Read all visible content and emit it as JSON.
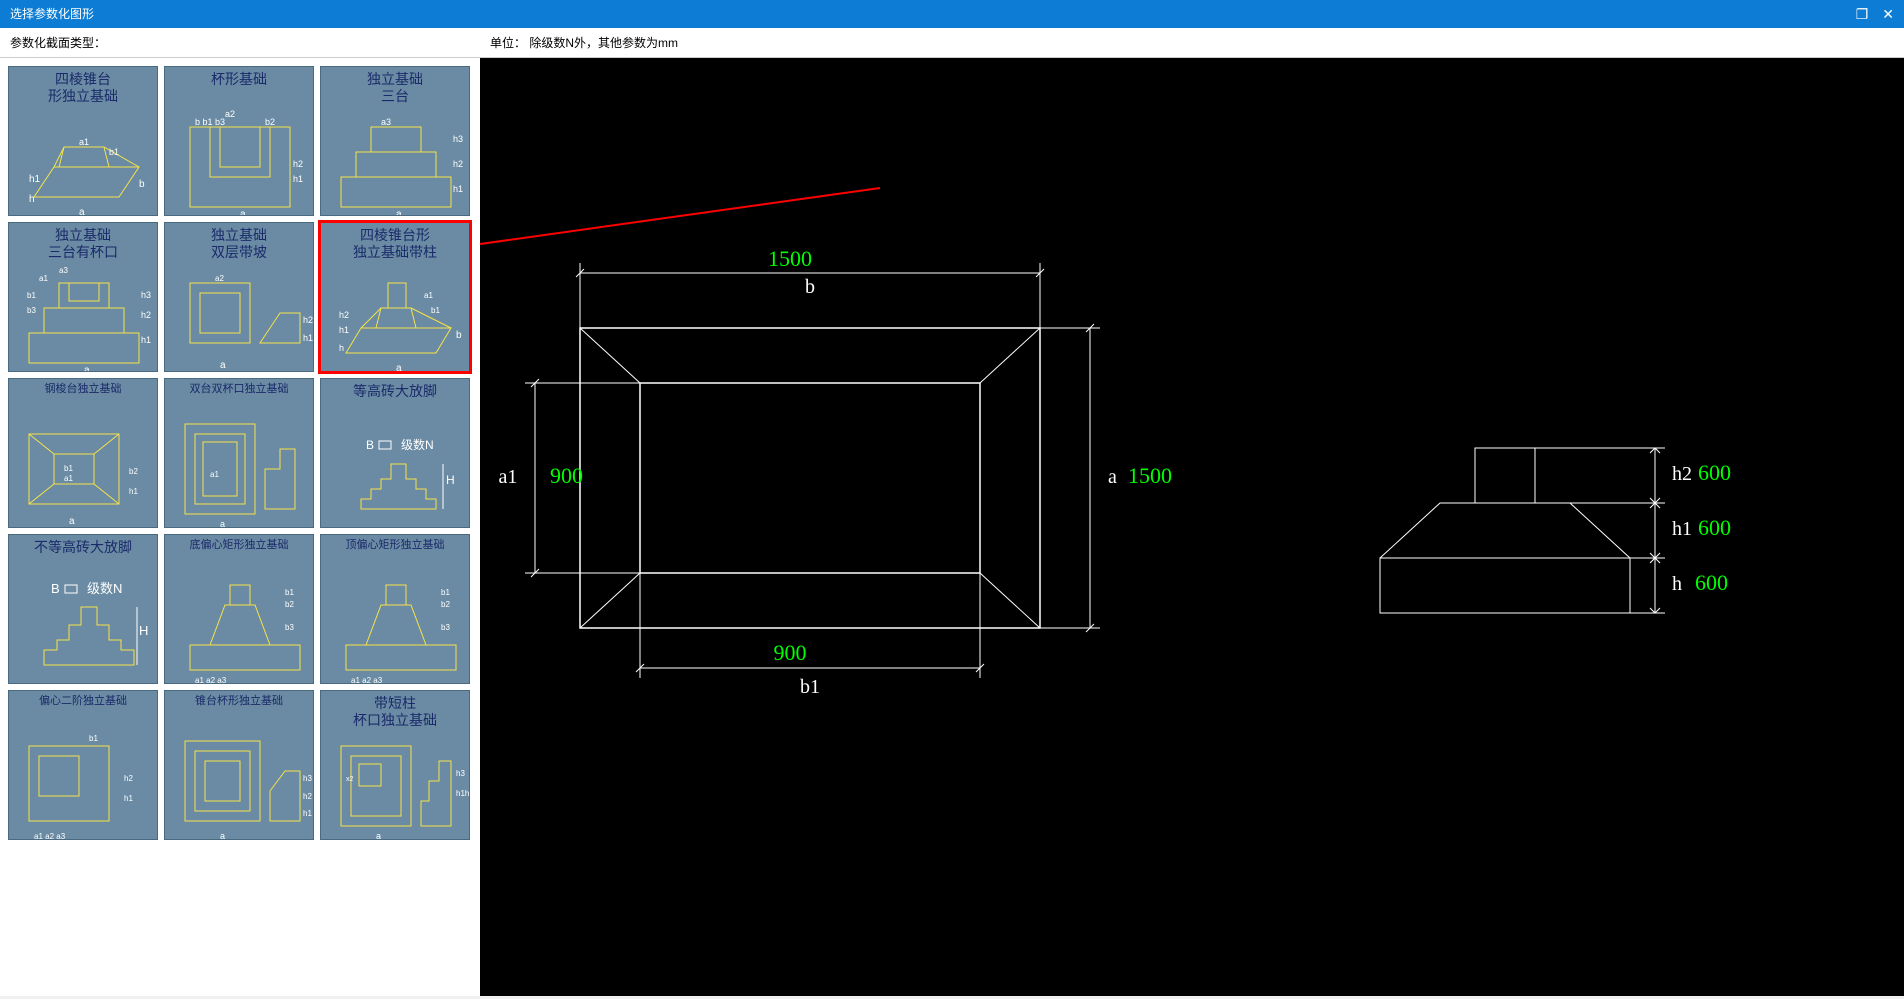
{
  "window": {
    "title": "选择参数化图形",
    "restore_icon": "❐",
    "close_icon": "✕"
  },
  "toolbar": {
    "type_label": "参数化截面类型：",
    "unit_label": "单位：   除级数N外，其他参数为mm"
  },
  "thumbs": [
    {
      "title": "四棱锥台\n形独立基础",
      "big": true
    },
    {
      "title": "杯形基础",
      "big": true
    },
    {
      "title": "独立基础\n三台",
      "big": true
    },
    {
      "title": "独立基础\n三台有杯口",
      "big": true
    },
    {
      "title": "独立基础\n双层带坡",
      "big": true
    },
    {
      "title": "四棱锥台形\n独立基础带柱",
      "big": true,
      "selected": true
    },
    {
      "title": "钢梭台独立基础"
    },
    {
      "title": "双台双杯口独立基础"
    },
    {
      "title": "等高砖大放脚",
      "big": true
    },
    {
      "title": "不等高砖大放脚",
      "big": true
    },
    {
      "title": "底偏心矩形独立基础"
    },
    {
      "title": "顶偏心矩形独立基础"
    },
    {
      "title": "偏心二阶独立基础"
    },
    {
      "title": "锥台杯形独立基础"
    },
    {
      "title": "带短柱\n杯口独立基础",
      "big": true
    }
  ],
  "preview": {
    "b_label": "b",
    "b_value": "1500",
    "a_label": "a",
    "a_value": "1500",
    "a1_label": "a1",
    "a1_value": "900",
    "b1_label": "b1",
    "b1_value": "900",
    "h2_label": "h2",
    "h2_value": "600",
    "h1_label": "h1",
    "h1_value": "600",
    "h_label": "h",
    "h_value": "600"
  },
  "thumb_small_labels": {
    "B": "B",
    "N": "级数N",
    "H": "H"
  }
}
